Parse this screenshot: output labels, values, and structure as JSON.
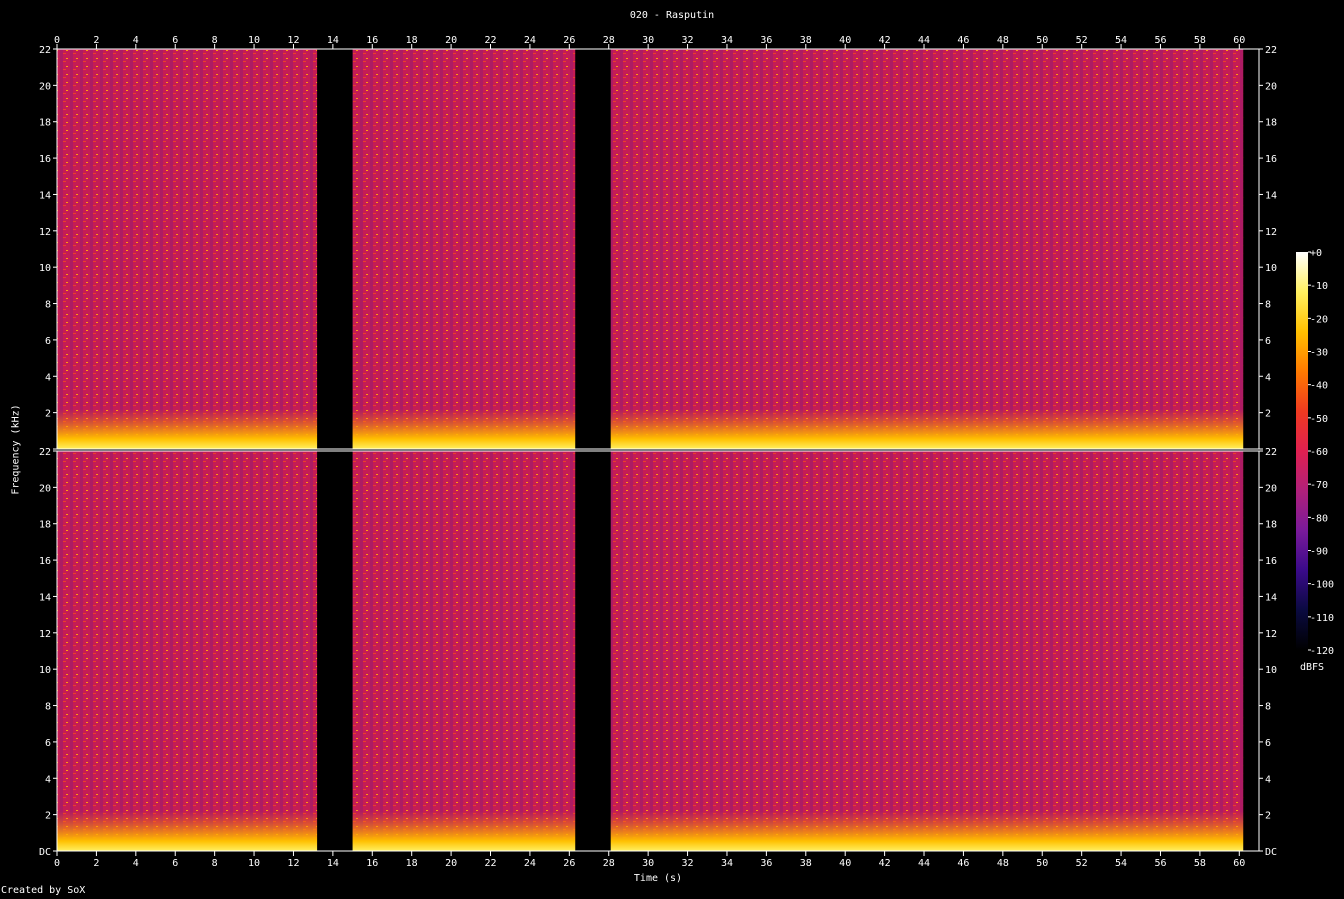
{
  "window": {
    "title": "020 - Rasputin",
    "credit": "Created by SoX"
  },
  "chart_data": {
    "type": "heatmap",
    "title": "020 - Rasputin",
    "xlabel": "Time (s)",
    "ylabel": "Frequency (kHz)",
    "xlim": [
      0,
      61
    ],
    "ylim_khz": [
      0,
      22
    ],
    "x_ticks": [
      "0",
      "2",
      "4",
      "6",
      "8",
      "10",
      "12",
      "14",
      "16",
      "18",
      "20",
      "22",
      "24",
      "26",
      "28",
      "30",
      "32",
      "34",
      "36",
      "38",
      "40",
      "42",
      "44",
      "46",
      "48",
      "50",
      "52",
      "54",
      "56",
      "58",
      "60"
    ],
    "y_ticks": [
      "DC",
      "2",
      "4",
      "6",
      "8",
      "10",
      "12",
      "14",
      "16",
      "18",
      "20",
      "22"
    ],
    "channels": 2,
    "silent_regions_s": [
      [
        13.2,
        15.0
      ],
      [
        26.3,
        28.1
      ],
      [
        60.2,
        61.0
      ]
    ],
    "colorbar": {
      "unit": "dBFS",
      "ticks": [
        "+0",
        "-10",
        "-20",
        "-30",
        "-40",
        "-50",
        "-60",
        "-70",
        "-80",
        "-90",
        "-100",
        "-110",
        "-120"
      ],
      "range_db": [
        -120,
        0
      ],
      "colors": [
        "#000000",
        "#0a0a40",
        "#3a0a8a",
        "#7a1a9a",
        "#b0207a",
        "#e02050",
        "#f03a20",
        "#ff7a00",
        "#ffc000",
        "#fff060",
        "#ffffff"
      ]
    }
  }
}
